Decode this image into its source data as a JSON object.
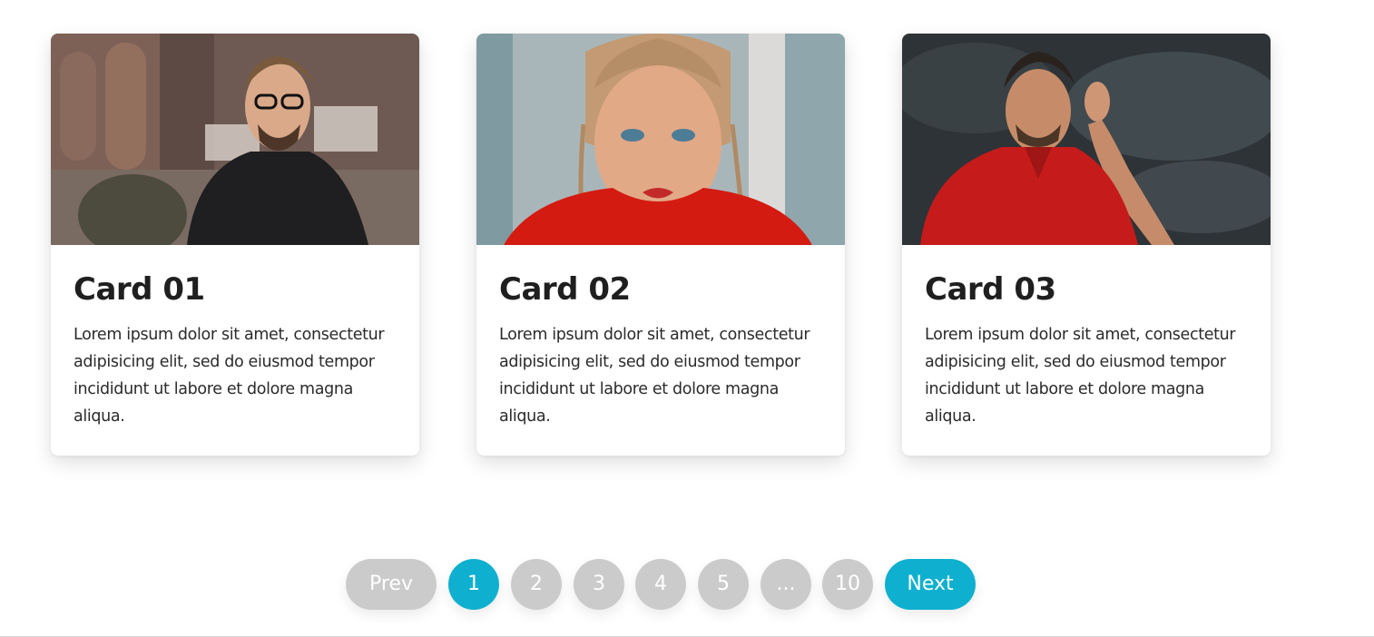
{
  "cards": [
    {
      "title": "Card 01",
      "text": "Lorem ipsum dolor sit amet, consectetur adipisicing elit, sed do eiusmod tempor incididunt ut labore et dolore magna aliqua.",
      "image": "photo-man-with-glasses-black-turtleneck"
    },
    {
      "title": "Card 02",
      "text": "Lorem ipsum dolor sit amet, consectetur adipisicing elit, sed do eiusmod tempor incididunt ut labore et dolore magna aliqua.",
      "image": "photo-woman-with-braids-red-top"
    },
    {
      "title": "Card 03",
      "text": "Lorem ipsum dolor sit amet, consectetur adipisicing elit, sed do eiusmod tempor incididunt ut labore et dolore magna aliqua.",
      "image": "photo-man-red-polo-hand-to-ear"
    }
  ],
  "pagination": {
    "prev_label": "Prev",
    "next_label": "Next",
    "pages": [
      "1",
      "2",
      "3",
      "4",
      "5",
      "...",
      "10"
    ],
    "active_page": "1",
    "accent_color": "#0fb0cf",
    "inactive_color": "#cbcbcb"
  }
}
